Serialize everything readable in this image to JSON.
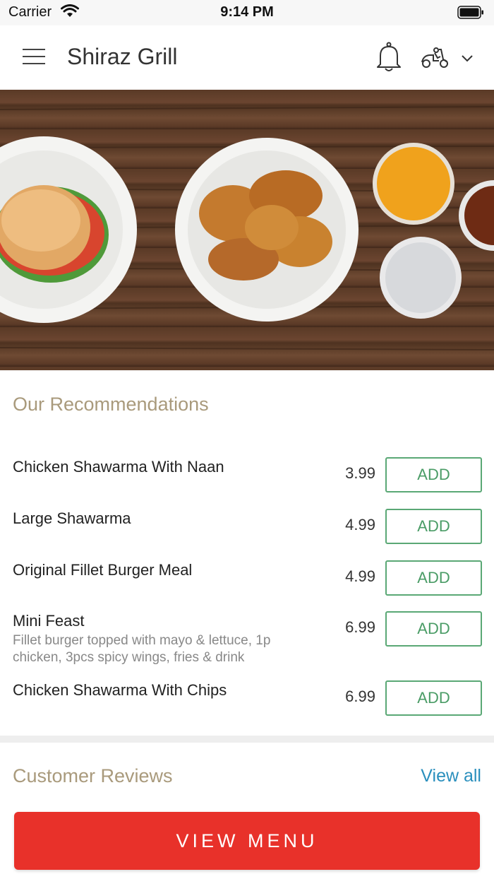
{
  "status_bar": {
    "carrier": "Carrier",
    "time": "9:14 PM",
    "icons": [
      "wifi-icon",
      "battery-icon"
    ]
  },
  "header": {
    "title": "Shiraz Grill",
    "icons": [
      "menu-icon",
      "bell-icon",
      "scooter-icon",
      "chevron-down-icon"
    ]
  },
  "hero": {
    "image": "food-banner-burger-fried-chicken-sauces"
  },
  "recommendations": {
    "title": "Our Recommendations",
    "add_label": "ADD",
    "items": [
      {
        "name": "Chicken Shawarma With Naan",
        "description": "",
        "price": "3.99"
      },
      {
        "name": "Large Shawarma",
        "description": "",
        "price": "4.99"
      },
      {
        "name": "Original Fillet Burger Meal",
        "description": "",
        "price": "4.99"
      },
      {
        "name": "Mini Feast",
        "description": "Fillet burger topped with mayo & lettuce, 1p chicken, 3pcs spicy wings, fries & drink",
        "price": "6.99"
      },
      {
        "name": "Chicken Shawarma With Chips",
        "description": "",
        "price": "6.99"
      }
    ]
  },
  "reviews": {
    "title": "Customer Reviews",
    "view_all": "View all"
  },
  "footer": {
    "view_menu": "VIEW MENU"
  },
  "colors": {
    "accent_red": "#e8312a",
    "add_green": "#4a9c66",
    "section_title": "#a99a7c",
    "link_blue": "#2a8fbd"
  }
}
